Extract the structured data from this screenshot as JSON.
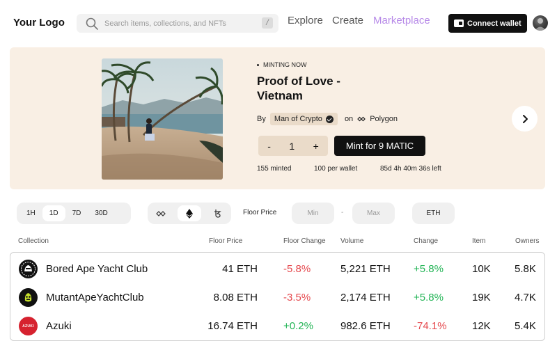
{
  "header": {
    "logo": "Your Logo",
    "search_placeholder": "Search items, collections, and NFTs",
    "search_shortcut": "/",
    "nav": [
      "Explore",
      "Create",
      "Marketplace"
    ],
    "active_nav": "Marketplace",
    "connect_wallet": "Connect wallet"
  },
  "hero": {
    "status": "MINTING NOW",
    "title": "Proof of Love - Vietnam",
    "by_label": "By",
    "creator": "Man of Crypto",
    "on_label": "on",
    "chain": "Polygon",
    "minus": "-",
    "quantity": "1",
    "plus": "+",
    "mint_button": "Mint for 9 MATIC",
    "minted": "155 minted",
    "per_wallet": "100 per wallet",
    "time_left": "85d 4h 40m 36s left"
  },
  "filters": {
    "time_ranges": [
      "1H",
      "1D",
      "7D",
      "30D"
    ],
    "active_time_range": "1D",
    "floor_price_label": "Floor Price",
    "min_placeholder": "Min",
    "range_separator": "-",
    "max_placeholder": "Max",
    "currency": "ETH"
  },
  "table": {
    "columns": [
      "Collection",
      "Floor Price",
      "Floor Change",
      "Volume",
      "Change",
      "Item",
      "Owners"
    ],
    "rows": [
      {
        "name": "Bored Ape Yacht Club",
        "floor": "41 ETH",
        "floor_change": "-5.8%",
        "volume": "5,221 ETH",
        "change": "+5.8%",
        "items": "10K",
        "owners": "5.8K"
      },
      {
        "name": "MutantApeYachtClub",
        "floor": "8.08 ETH",
        "floor_change": "-3.5%",
        "volume": "2,174 ETH",
        "change": "+5.8%",
        "items": "19K",
        "owners": "4.7K"
      },
      {
        "name": "Azuki",
        "floor": "16.74 ETH",
        "floor_change": "+0.2%",
        "volume": "982.6 ETH",
        "change": "-74.1%",
        "items": "12K",
        "owners": "5.4K",
        "logo_text": "AZUKI"
      }
    ]
  },
  "colors": {
    "accent": "#b78ae8",
    "hero_bg": "#f9efe4",
    "negative": "#e5484d",
    "positive": "#22b455"
  }
}
